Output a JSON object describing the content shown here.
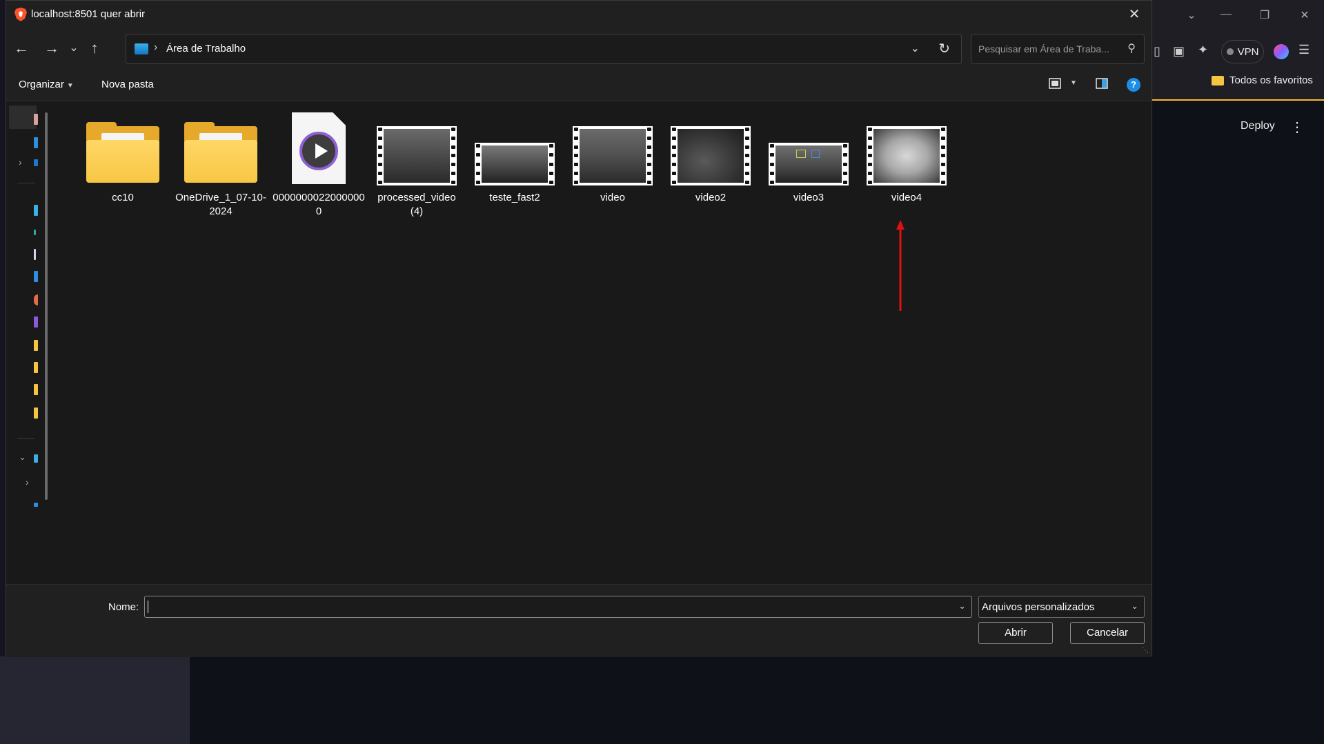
{
  "dialog": {
    "title": "localhost:8501 quer abrir",
    "address_path": "Área de Trabalho",
    "search_placeholder": "Pesquisar em Área de Traba...",
    "commands": {
      "organize": "Organizar",
      "new_folder": "Nova pasta"
    },
    "files": [
      {
        "name": "cc10",
        "kind": "folder"
      },
      {
        "name": "OneDrive_1_07-10-2024",
        "kind": "folder"
      },
      {
        "name": "00000000220000000",
        "kind": "media-file"
      },
      {
        "name": "processed_video (4)",
        "kind": "video"
      },
      {
        "name": "teste_fast2",
        "kind": "video"
      },
      {
        "name": "video",
        "kind": "video"
      },
      {
        "name": "video2",
        "kind": "video"
      },
      {
        "name": "video3",
        "kind": "video"
      },
      {
        "name": "video4",
        "kind": "video"
      }
    ],
    "filename_label": "Nome:",
    "filename_value": "",
    "file_type": "Arquivos personalizados",
    "open_button": "Abrir",
    "cancel_button": "Cancelar",
    "help_glyph": "?"
  },
  "browser": {
    "vpn_label": "VPN",
    "bookmarks_folder": "Todos os favoritos",
    "deploy_label": "Deploy"
  },
  "colors": {
    "accent_arrow": "#e01010",
    "help_blue": "#1d8ee8",
    "folder_yellow": "#f7c644"
  }
}
